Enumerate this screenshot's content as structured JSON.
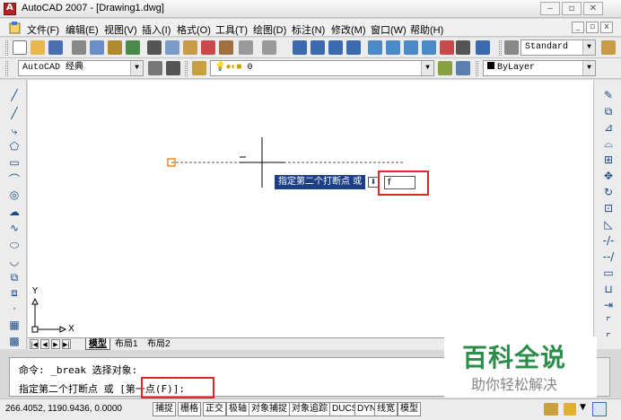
{
  "window": {
    "title": "AutoCAD 2007 - [Drawing1.dwg]"
  },
  "menubar": {
    "items": [
      "文件(F)",
      "编辑(E)",
      "视图(V)",
      "插入(I)",
      "格式(O)",
      "工具(T)",
      "绘图(D)",
      "标注(N)",
      "修改(M)",
      "窗口(W)",
      "帮助(H)"
    ]
  },
  "toolbar": {
    "text_style": "Standard",
    "workspace": "AutoCAD 经典",
    "layer": "0",
    "color": "ByLayer"
  },
  "canvas": {
    "tooltip": "指定第二个打断点 或",
    "dyn_input_value": "f",
    "ucs_y": "Y",
    "ucs_x": "X"
  },
  "tabs": [
    "模型",
    "布局1",
    "布局2"
  ],
  "command": {
    "line1": "命令: _break 选择对象:",
    "line2_prefix": "指定第二个打断点 或 [",
    "line2_option": "第一点(F)]:"
  },
  "status": {
    "coords": "266.4052, 1190.9436, 0.0000",
    "buttons": [
      "捕捉",
      "栅格",
      "正交",
      "极轴",
      "对象捕捉",
      "对象追踪",
      "DUCS",
      "DYN",
      "线宽",
      "模型"
    ]
  },
  "watermark": {
    "title": "百科全说",
    "subtitle": "助你轻松解决"
  },
  "colors": {
    "highlight": "#e0262b",
    "tooltip_bg": "#1c3f86",
    "watermark": "#2c8c4a"
  }
}
